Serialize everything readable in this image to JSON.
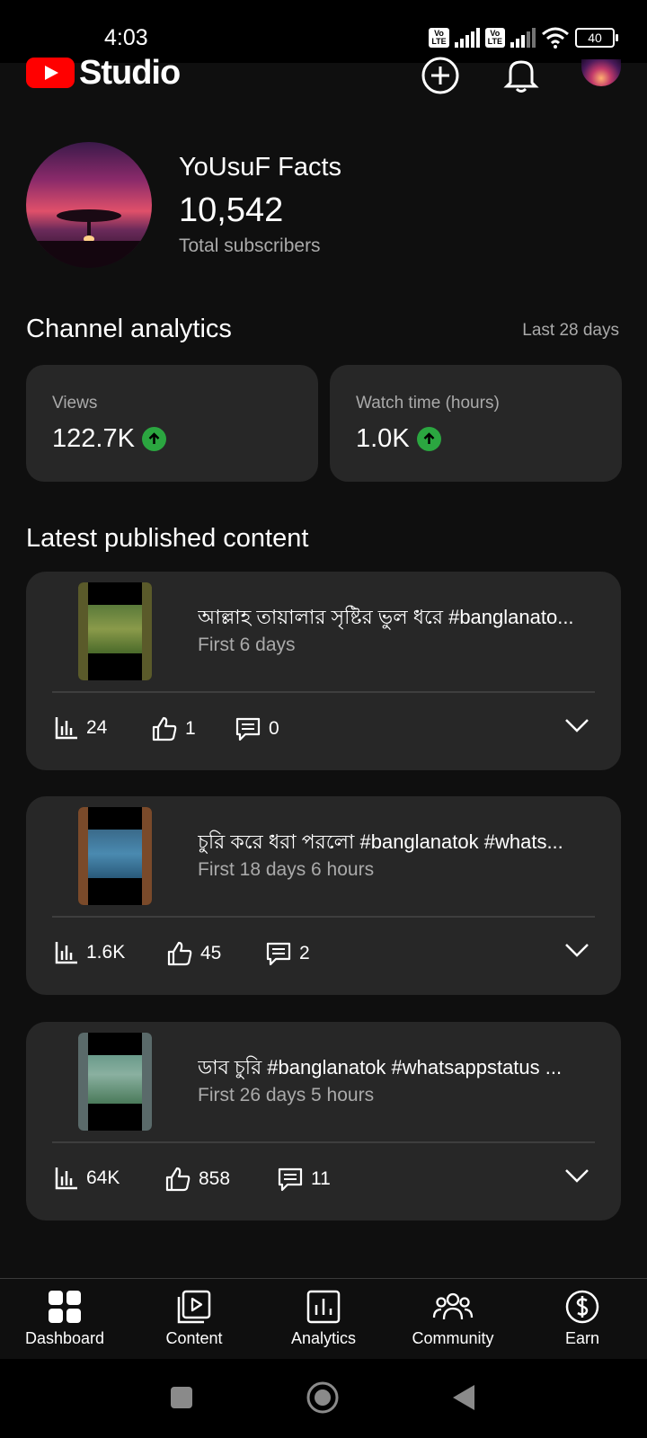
{
  "status_bar": {
    "time": "4:03",
    "battery": "40"
  },
  "header": {
    "logo_text": "Studio",
    "icons": [
      "create-icon",
      "notifications-bell-icon",
      "account-avatar"
    ]
  },
  "channel": {
    "name": "YoUsuF Facts",
    "subscribers": "10,542",
    "subscribers_label": "Total subscribers"
  },
  "analytics": {
    "title": "Channel analytics",
    "period": "Last 28 days",
    "cards": [
      {
        "label": "Views",
        "value": "122.7K",
        "trend": "up"
      },
      {
        "label": "Watch time (hours)",
        "value": "1.0K",
        "trend": "up"
      }
    ]
  },
  "latest": {
    "title": "Latest published content",
    "items": [
      {
        "title": "আল্লাহ তায়ালার সৃষ্টির ভুল ধরে #banglanato...",
        "age": "First 6 days",
        "views": "24",
        "likes": "1",
        "comments": "0"
      },
      {
        "title": "চুরি করে ধরা পরলো #banglanatok #whats...",
        "age": "First 18 days 6 hours",
        "views": "1.6K",
        "likes": "45",
        "comments": "2"
      },
      {
        "title": "ডাব চুরি #banglanatok #whatsappstatus ...",
        "age": "First 26 days 5 hours",
        "views": "64K",
        "likes": "858",
        "comments": "11"
      }
    ]
  },
  "bottom_nav": {
    "items": [
      {
        "label": "Dashboard",
        "icon": "dashboard-icon"
      },
      {
        "label": "Content",
        "icon": "content-icon"
      },
      {
        "label": "Analytics",
        "icon": "analytics-icon"
      },
      {
        "label": "Community",
        "icon": "community-icon"
      },
      {
        "label": "Earn",
        "icon": "earn-icon"
      }
    ]
  },
  "colors": {
    "background": "#0f0f0f",
    "card": "#272727",
    "brand_red": "#ff0000",
    "trend_green": "#2ba640",
    "secondary_text": "#aaaaaa"
  }
}
